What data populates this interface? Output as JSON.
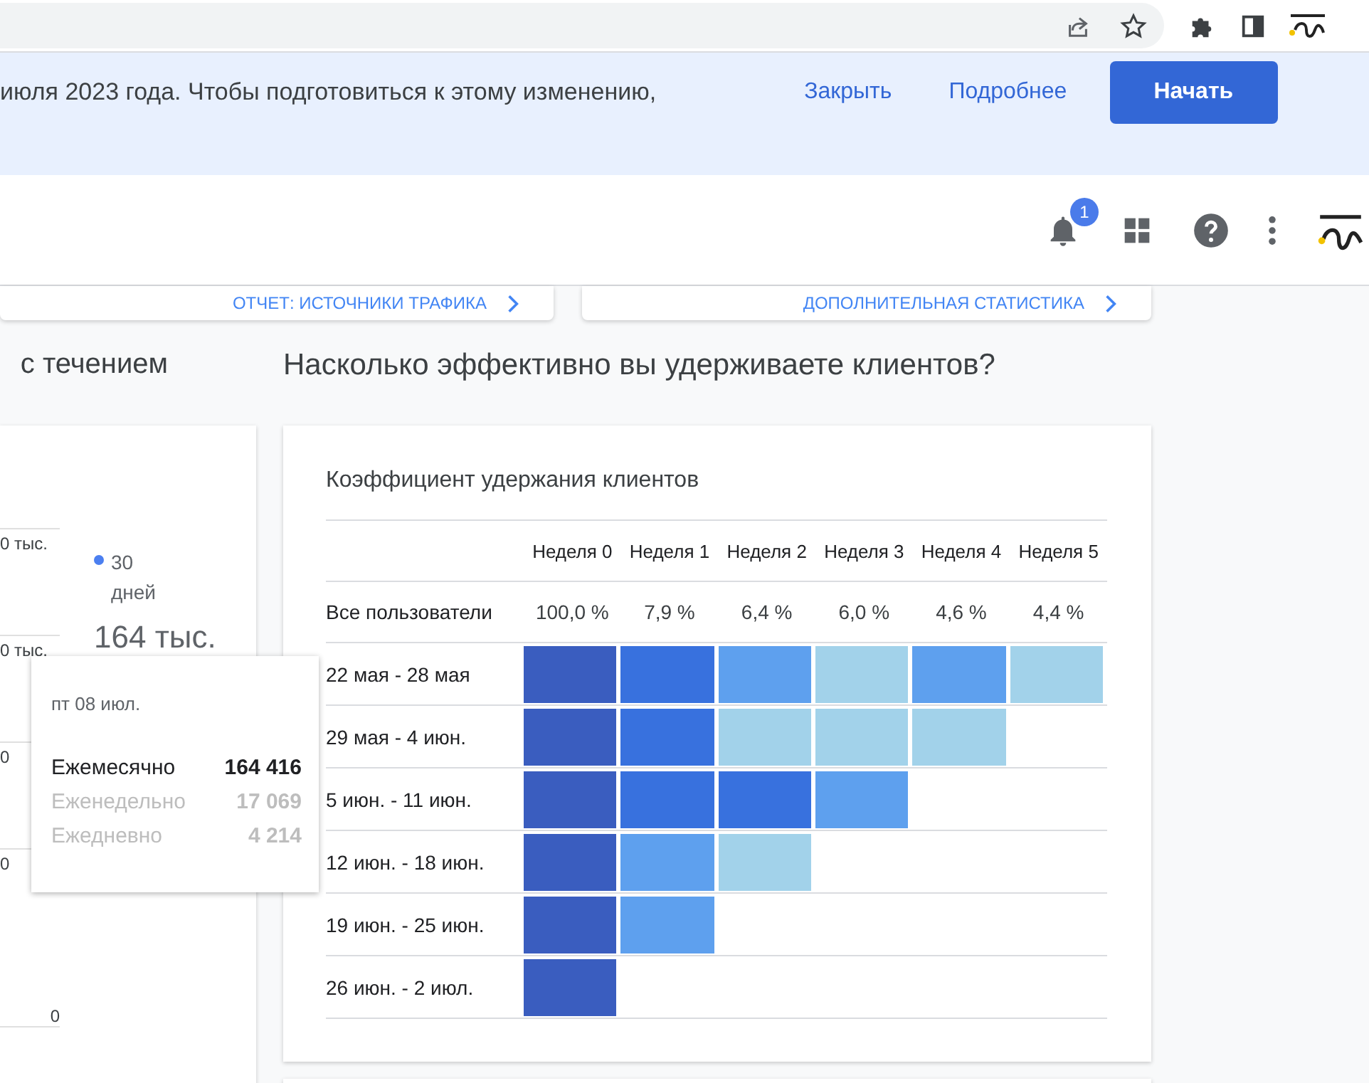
{
  "banner": {
    "text": "июля 2023 года. Чтобы подготовиться к этому изменению,",
    "links": [
      "Закрыть",
      "Подробнее"
    ],
    "button": "Начать"
  },
  "header": {
    "notifications_badge": "1"
  },
  "top_cards": [
    "ОТЧЕТ: ИСТОЧНИКИ ТРАФИКА",
    "ДОПОЛНИТЕЛЬНАЯ СТАТИСТИКА"
  ],
  "left_section": {
    "heading": "с течением",
    "axis_labels": [
      "0 тыс.",
      "0 тыс.",
      "0",
      "0",
      "0"
    ],
    "legend": [
      {
        "label": "30 дней",
        "value": "164 тыс.",
        "color": "#4b7ff0"
      }
    ]
  },
  "tooltip": {
    "date": "пт 08 июл.",
    "rows": [
      {
        "label": "Ежемесячно",
        "value": "164 416",
        "selected": true
      },
      {
        "label": "Еженедельно",
        "value": "17 069",
        "selected": false
      },
      {
        "label": "Ежедневно",
        "value": "4 214",
        "selected": false
      }
    ]
  },
  "retention": {
    "heading": "Насколько эффективно вы удерживаете клиентов?",
    "title": "Коэффициент удержания клиентов",
    "columns": [
      "Неделя 0",
      "Неделя 1",
      "Неделя 2",
      "Неделя 3",
      "Неделя 4",
      "Неделя 5"
    ],
    "all_users": {
      "label": "Все пользователи",
      "values": [
        "100,0 %",
        "7,9 %",
        "6,4 %",
        "6,0 %",
        "4,6 %",
        "4,4 %"
      ]
    },
    "rows": [
      {
        "label": "22 мая - 28 мая",
        "cells": [
          {
            "color": "#3a5dbf"
          },
          {
            "color": "#3871de"
          },
          {
            "color": "#5ea0ee"
          },
          {
            "color": "#a2d2ea"
          },
          {
            "color": "#5ea0ee"
          },
          {
            "color": "#a2d2ea"
          }
        ]
      },
      {
        "label": "29 мая - 4 июн.",
        "cells": [
          {
            "color": "#3a5dbf"
          },
          {
            "color": "#3871de"
          },
          {
            "color": "#a2d2ea"
          },
          {
            "color": "#a2d2ea"
          },
          {
            "color": "#a2d2ea"
          }
        ]
      },
      {
        "label": "5 июн. - 11 июн.",
        "cells": [
          {
            "color": "#3a5dbf"
          },
          {
            "color": "#3871de"
          },
          {
            "color": "#3871de"
          },
          {
            "color": "#5ea0ee"
          }
        ]
      },
      {
        "label": "12 июн. - 18 июн.",
        "cells": [
          {
            "color": "#3a5dbf"
          },
          {
            "color": "#5ea0ee"
          },
          {
            "color": "#a2d2ea"
          }
        ]
      },
      {
        "label": "19 июн. - 25 июн.",
        "cells": [
          {
            "color": "#3a5dbf"
          },
          {
            "color": "#5ea0ee"
          }
        ]
      },
      {
        "label": "26 июн. - 2 июл.",
        "cells": [
          {
            "color": "#3a5dbf"
          }
        ]
      }
    ]
  }
}
